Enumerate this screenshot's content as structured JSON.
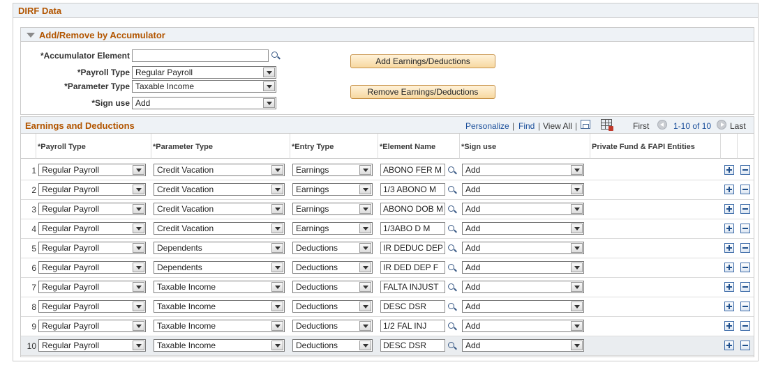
{
  "page": {
    "title": "DIRF Data"
  },
  "accumulator_section": {
    "title": "Add/Remove by Accumulator",
    "accumulator_element_label": "*Accumulator Element",
    "accumulator_element_value": "",
    "payroll_type_label": "*Payroll Type",
    "payroll_type_value": "Regular Payroll",
    "parameter_type_label": "*Parameter Type",
    "parameter_type_value": "Taxable Income",
    "sign_use_label": "*Sign use",
    "sign_use_value": "Add",
    "add_button": "Add Earnings/Deductions",
    "remove_button": "Remove Earnings/Deductions"
  },
  "grid": {
    "title": "Earnings and Deductions",
    "nav": {
      "personalize": "Personalize",
      "find": "Find",
      "view_all": "View All",
      "first": "First",
      "range": "1-10 of 10",
      "last": "Last"
    },
    "columns": {
      "payroll_type": "*Payroll Type",
      "parameter_type": "*Parameter Type",
      "entry_type": "*Entry Type",
      "element_name": "*Element Name",
      "sign_use": "*Sign use",
      "private_fund": "Private Fund & FAPI Entities"
    },
    "rows": [
      {
        "num": "1",
        "payroll_type": "Regular Payroll",
        "parameter_type": "Credit Vacation",
        "entry_type": "Earnings",
        "element_name": "ABONO FER M",
        "sign_use": "Add"
      },
      {
        "num": "2",
        "payroll_type": "Regular Payroll",
        "parameter_type": "Credit Vacation",
        "entry_type": "Earnings",
        "element_name": "1/3 ABONO M",
        "sign_use": "Add"
      },
      {
        "num": "3",
        "payroll_type": "Regular Payroll",
        "parameter_type": "Credit Vacation",
        "entry_type": "Earnings",
        "element_name": "ABONO DOB M",
        "sign_use": "Add"
      },
      {
        "num": "4",
        "payroll_type": "Regular Payroll",
        "parameter_type": "Credit Vacation",
        "entry_type": "Earnings",
        "element_name": "1/3ABO D M",
        "sign_use": "Add"
      },
      {
        "num": "5",
        "payroll_type": "Regular Payroll",
        "parameter_type": "Dependents",
        "entry_type": "Deductions",
        "element_name": "IR DEDUC DEP",
        "sign_use": "Add"
      },
      {
        "num": "6",
        "payroll_type": "Regular Payroll",
        "parameter_type": "Dependents",
        "entry_type": "Deductions",
        "element_name": "IR DED DEP F",
        "sign_use": "Add"
      },
      {
        "num": "7",
        "payroll_type": "Regular Payroll",
        "parameter_type": "Taxable Income",
        "entry_type": "Deductions",
        "element_name": "FALTA INJUST",
        "sign_use": "Add"
      },
      {
        "num": "8",
        "payroll_type": "Regular Payroll",
        "parameter_type": "Taxable Income",
        "entry_type": "Deductions",
        "element_name": "DESC DSR",
        "sign_use": "Add"
      },
      {
        "num": "9",
        "payroll_type": "Regular Payroll",
        "parameter_type": "Taxable Income",
        "entry_type": "Deductions",
        "element_name": "1/2 FAL INJ",
        "sign_use": "Add"
      },
      {
        "num": "10",
        "payroll_type": "Regular Payroll",
        "parameter_type": "Taxable Income",
        "entry_type": "Deductions",
        "element_name": "DESC DSR",
        "sign_use": "Add"
      }
    ]
  },
  "colors": {
    "section_title": "#b25500",
    "header_bg": "#eef2f6",
    "link": "#1a4e9a",
    "button_border": "#c69146",
    "selected_row_bg": "#eaedf0"
  },
  "icons": [
    "collapse-triangle-icon",
    "search-icon",
    "zoom-icon",
    "download-grid-icon",
    "first-arrow-icon",
    "last-arrow-icon",
    "add-row-icon",
    "delete-row-icon",
    "dropdown-arrow-icon"
  ]
}
